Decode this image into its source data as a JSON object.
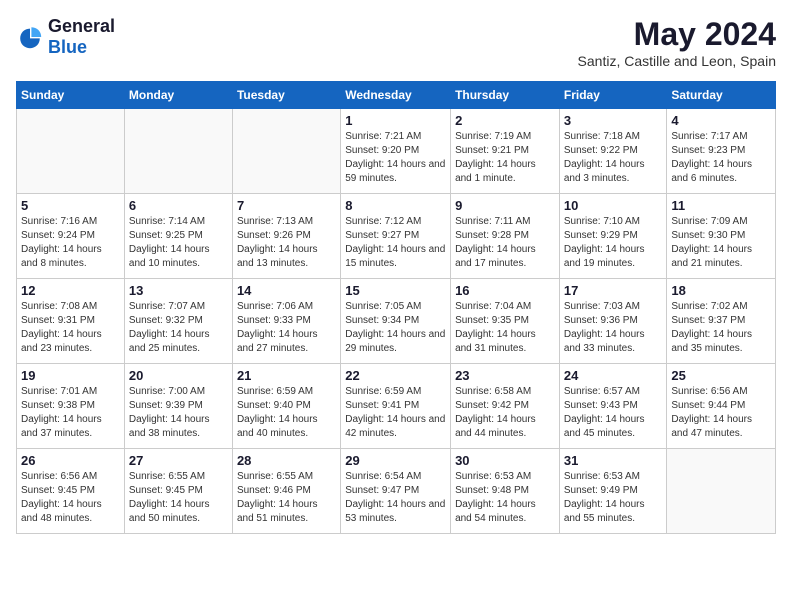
{
  "header": {
    "logo": {
      "general": "General",
      "blue": "Blue"
    },
    "title": "May 2024",
    "location": "Santiz, Castille and Leon, Spain"
  },
  "calendar": {
    "days_of_week": [
      "Sunday",
      "Monday",
      "Tuesday",
      "Wednesday",
      "Thursday",
      "Friday",
      "Saturday"
    ],
    "weeks": [
      [
        {
          "day": "",
          "info": ""
        },
        {
          "day": "",
          "info": ""
        },
        {
          "day": "",
          "info": ""
        },
        {
          "day": "1",
          "sunrise": "Sunrise: 7:21 AM",
          "sunset": "Sunset: 9:20 PM",
          "daylight": "Daylight: 14 hours and 59 minutes."
        },
        {
          "day": "2",
          "sunrise": "Sunrise: 7:19 AM",
          "sunset": "Sunset: 9:21 PM",
          "daylight": "Daylight: 14 hours and 1 minute."
        },
        {
          "day": "3",
          "sunrise": "Sunrise: 7:18 AM",
          "sunset": "Sunset: 9:22 PM",
          "daylight": "Daylight: 14 hours and 3 minutes."
        },
        {
          "day": "4",
          "sunrise": "Sunrise: 7:17 AM",
          "sunset": "Sunset: 9:23 PM",
          "daylight": "Daylight: 14 hours and 6 minutes."
        }
      ],
      [
        {
          "day": "5",
          "sunrise": "Sunrise: 7:16 AM",
          "sunset": "Sunset: 9:24 PM",
          "daylight": "Daylight: 14 hours and 8 minutes."
        },
        {
          "day": "6",
          "sunrise": "Sunrise: 7:14 AM",
          "sunset": "Sunset: 9:25 PM",
          "daylight": "Daylight: 14 hours and 10 minutes."
        },
        {
          "day": "7",
          "sunrise": "Sunrise: 7:13 AM",
          "sunset": "Sunset: 9:26 PM",
          "daylight": "Daylight: 14 hours and 13 minutes."
        },
        {
          "day": "8",
          "sunrise": "Sunrise: 7:12 AM",
          "sunset": "Sunset: 9:27 PM",
          "daylight": "Daylight: 14 hours and 15 minutes."
        },
        {
          "day": "9",
          "sunrise": "Sunrise: 7:11 AM",
          "sunset": "Sunset: 9:28 PM",
          "daylight": "Daylight: 14 hours and 17 minutes."
        },
        {
          "day": "10",
          "sunrise": "Sunrise: 7:10 AM",
          "sunset": "Sunset: 9:29 PM",
          "daylight": "Daylight: 14 hours and 19 minutes."
        },
        {
          "day": "11",
          "sunrise": "Sunrise: 7:09 AM",
          "sunset": "Sunset: 9:30 PM",
          "daylight": "Daylight: 14 hours and 21 minutes."
        }
      ],
      [
        {
          "day": "12",
          "sunrise": "Sunrise: 7:08 AM",
          "sunset": "Sunset: 9:31 PM",
          "daylight": "Daylight: 14 hours and 23 minutes."
        },
        {
          "day": "13",
          "sunrise": "Sunrise: 7:07 AM",
          "sunset": "Sunset: 9:32 PM",
          "daylight": "Daylight: 14 hours and 25 minutes."
        },
        {
          "day": "14",
          "sunrise": "Sunrise: 7:06 AM",
          "sunset": "Sunset: 9:33 PM",
          "daylight": "Daylight: 14 hours and 27 minutes."
        },
        {
          "day": "15",
          "sunrise": "Sunrise: 7:05 AM",
          "sunset": "Sunset: 9:34 PM",
          "daylight": "Daylight: 14 hours and 29 minutes."
        },
        {
          "day": "16",
          "sunrise": "Sunrise: 7:04 AM",
          "sunset": "Sunset: 9:35 PM",
          "daylight": "Daylight: 14 hours and 31 minutes."
        },
        {
          "day": "17",
          "sunrise": "Sunrise: 7:03 AM",
          "sunset": "Sunset: 9:36 PM",
          "daylight": "Daylight: 14 hours and 33 minutes."
        },
        {
          "day": "18",
          "sunrise": "Sunrise: 7:02 AM",
          "sunset": "Sunset: 9:37 PM",
          "daylight": "Daylight: 14 hours and 35 minutes."
        }
      ],
      [
        {
          "day": "19",
          "sunrise": "Sunrise: 7:01 AM",
          "sunset": "Sunset: 9:38 PM",
          "daylight": "Daylight: 14 hours and 37 minutes."
        },
        {
          "day": "20",
          "sunrise": "Sunrise: 7:00 AM",
          "sunset": "Sunset: 9:39 PM",
          "daylight": "Daylight: 14 hours and 38 minutes."
        },
        {
          "day": "21",
          "sunrise": "Sunrise: 6:59 AM",
          "sunset": "Sunset: 9:40 PM",
          "daylight": "Daylight: 14 hours and 40 minutes."
        },
        {
          "day": "22",
          "sunrise": "Sunrise: 6:59 AM",
          "sunset": "Sunset: 9:41 PM",
          "daylight": "Daylight: 14 hours and 42 minutes."
        },
        {
          "day": "23",
          "sunrise": "Sunrise: 6:58 AM",
          "sunset": "Sunset: 9:42 PM",
          "daylight": "Daylight: 14 hours and 44 minutes."
        },
        {
          "day": "24",
          "sunrise": "Sunrise: 6:57 AM",
          "sunset": "Sunset: 9:43 PM",
          "daylight": "Daylight: 14 hours and 45 minutes."
        },
        {
          "day": "25",
          "sunrise": "Sunrise: 6:56 AM",
          "sunset": "Sunset: 9:44 PM",
          "daylight": "Daylight: 14 hours and 47 minutes."
        }
      ],
      [
        {
          "day": "26",
          "sunrise": "Sunrise: 6:56 AM",
          "sunset": "Sunset: 9:45 PM",
          "daylight": "Daylight: 14 hours and 48 minutes."
        },
        {
          "day": "27",
          "sunrise": "Sunrise: 6:55 AM",
          "sunset": "Sunset: 9:45 PM",
          "daylight": "Daylight: 14 hours and 50 minutes."
        },
        {
          "day": "28",
          "sunrise": "Sunrise: 6:55 AM",
          "sunset": "Sunset: 9:46 PM",
          "daylight": "Daylight: 14 hours and 51 minutes."
        },
        {
          "day": "29",
          "sunrise": "Sunrise: 6:54 AM",
          "sunset": "Sunset: 9:47 PM",
          "daylight": "Daylight: 14 hours and 53 minutes."
        },
        {
          "day": "30",
          "sunrise": "Sunrise: 6:53 AM",
          "sunset": "Sunset: 9:48 PM",
          "daylight": "Daylight: 14 hours and 54 minutes."
        },
        {
          "day": "31",
          "sunrise": "Sunrise: 6:53 AM",
          "sunset": "Sunset: 9:49 PM",
          "daylight": "Daylight: 14 hours and 55 minutes."
        },
        {
          "day": "",
          "info": ""
        }
      ]
    ]
  }
}
